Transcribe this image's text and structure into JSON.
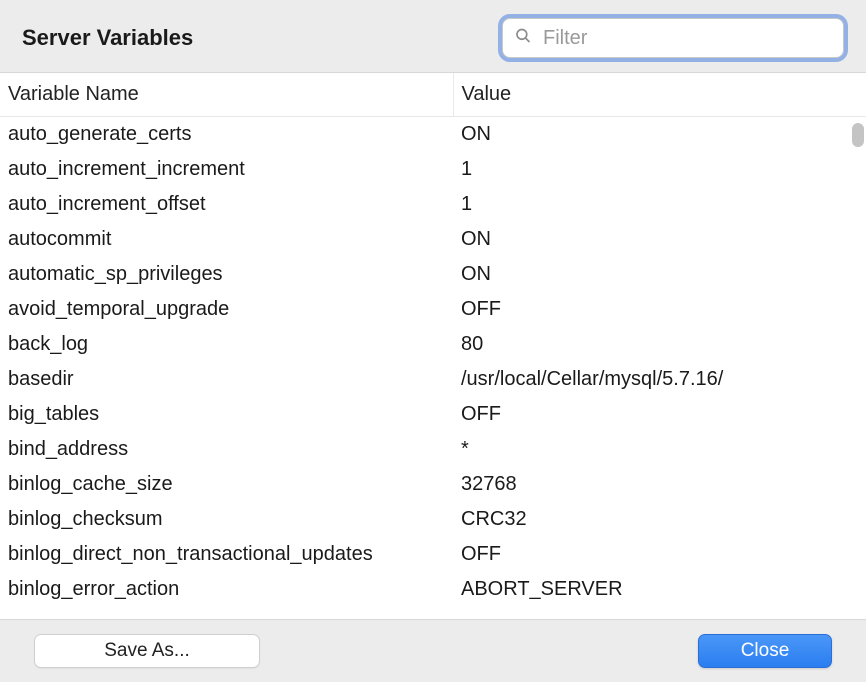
{
  "header": {
    "title": "Server Variables",
    "filter_placeholder": "Filter"
  },
  "columns": {
    "name": "Variable Name",
    "value": "Value"
  },
  "rows": [
    {
      "name": "auto_generate_certs",
      "value": "ON"
    },
    {
      "name": "auto_increment_increment",
      "value": "1"
    },
    {
      "name": "auto_increment_offset",
      "value": "1"
    },
    {
      "name": "autocommit",
      "value": "ON"
    },
    {
      "name": "automatic_sp_privileges",
      "value": "ON"
    },
    {
      "name": "avoid_temporal_upgrade",
      "value": "OFF"
    },
    {
      "name": "back_log",
      "value": "80"
    },
    {
      "name": "basedir",
      "value": "/usr/local/Cellar/mysql/5.7.16/"
    },
    {
      "name": "big_tables",
      "value": "OFF"
    },
    {
      "name": "bind_address",
      "value": "*"
    },
    {
      "name": "binlog_cache_size",
      "value": "32768"
    },
    {
      "name": "binlog_checksum",
      "value": "CRC32"
    },
    {
      "name": "binlog_direct_non_transactional_updates",
      "value": "OFF"
    },
    {
      "name": "binlog_error_action",
      "value": "ABORT_SERVER"
    }
  ],
  "footer": {
    "save_as": "Save As...",
    "close": "Close"
  }
}
